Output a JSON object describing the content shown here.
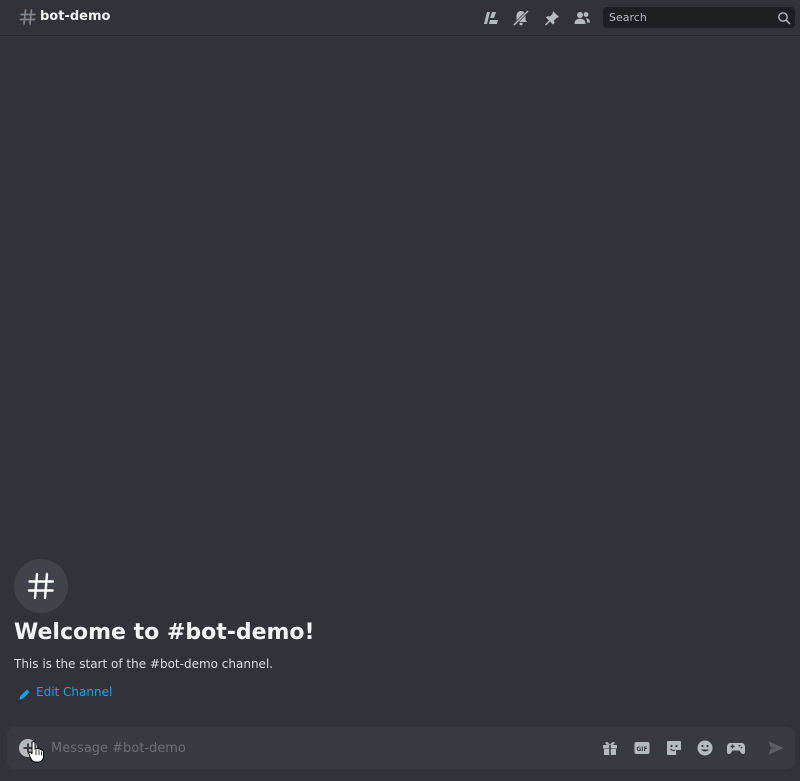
{
  "header": {
    "channel_name": "bot-demo",
    "icons": [
      "threads-icon",
      "mute-bell-icon",
      "pin-icon",
      "members-icon"
    ],
    "search": {
      "placeholder": "Search"
    }
  },
  "welcome": {
    "title": "Welcome to #bot-demo!",
    "subtitle": "This is the start of the #bot-demo channel.",
    "edit_channel_label": "Edit Channel"
  },
  "composer": {
    "placeholder": "Message #bot-demo",
    "icons": [
      "add-icon",
      "gift-icon",
      "gif-icon",
      "sticker-icon",
      "emoji-icon",
      "activities-icon",
      "send-icon"
    ]
  },
  "colors": {
    "background": "#313338",
    "composer_bg": "#383a40",
    "search_bg": "#1e1f22",
    "link": "#00a8fc",
    "icon": "#b5bac1"
  }
}
